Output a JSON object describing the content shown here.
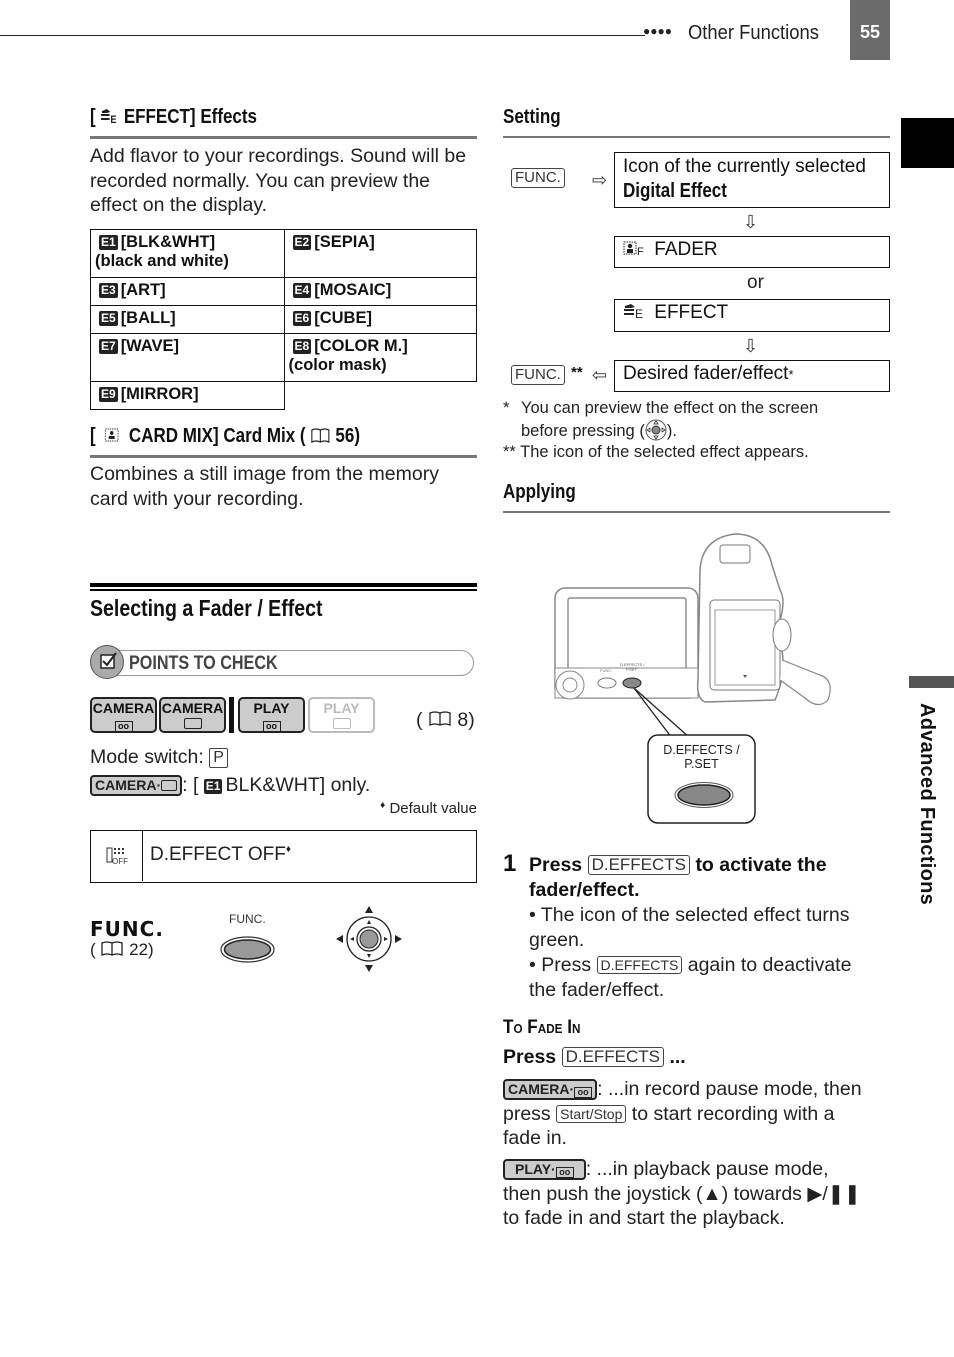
{
  "header": {
    "dots": "●●●●",
    "section_title": "Other Functions",
    "page_number": "55"
  },
  "side_tab": {
    "label": "Advanced Functions"
  },
  "effects": {
    "heading_prefix": "[",
    "heading_text": "EFFECT] Effects",
    "icon": "effect-icon",
    "description": "Add flavor to your recordings. Sound will be recorded normally. You can preview the effect on the display.",
    "table": [
      [
        {
          "badge": "E1",
          "label": "[BLK&WHT]",
          "sub": "(black and white)"
        },
        {
          "badge": "E2",
          "label": "[SEPIA]",
          "sub": ""
        }
      ],
      [
        {
          "badge": "E3",
          "label": "[ART]",
          "sub": ""
        },
        {
          "badge": "E4",
          "label": "[MOSAIC]",
          "sub": ""
        }
      ],
      [
        {
          "badge": "E5",
          "label": "[BALL]",
          "sub": ""
        },
        {
          "badge": "E6",
          "label": "[CUBE]",
          "sub": ""
        }
      ],
      [
        {
          "badge": "E7",
          "label": "[WAVE]",
          "sub": ""
        },
        {
          "badge": "E8",
          "label": "[COLOR M.]",
          "sub": "(color mask)"
        }
      ],
      [
        {
          "badge": "E9",
          "label": "[MIRROR]",
          "sub": ""
        }
      ]
    ]
  },
  "card_mix": {
    "heading_prefix": "[",
    "heading_text": "CARD MIX] Card Mix (",
    "page_ref": "56)",
    "description": "Combines a still image from the memory card with your recording."
  },
  "selecting": {
    "title": "Selecting a Fader / Effect",
    "points_to_check": "POINTS TO CHECK",
    "modes": [
      {
        "label": "CAMERA",
        "media": "tape",
        "active": true
      },
      {
        "label": "CAMERA",
        "media": "card",
        "active": true
      },
      {
        "label": "PLAY",
        "media": "tape",
        "active": true
      },
      {
        "label": "PLAY",
        "media": "card",
        "active": false
      }
    ],
    "mode_ref_open": "(",
    "mode_ref_page": "8)",
    "mode_switch_label": "Mode switch:",
    "mode_switch_value": "P",
    "camera_card_pill": "CAMERA·",
    "camera_card_note_pre": ": [",
    "camera_card_badge": "E1",
    "camera_card_note_post": "BLK&WHT] only.",
    "default_mark": "♦",
    "default_value_label": "Default value",
    "setting_icon_label": "OFF",
    "setting_value": "D.EFFECT OFF",
    "func_label": "FUNC.",
    "func_ref_open": "(",
    "func_ref_page": "22)",
    "func_button_caption": "FUNC."
  },
  "setting": {
    "title": "Setting",
    "func_key": "FUNC.",
    "box1_line1": "Icon of the currently selected",
    "box1_line2": "Digital Effect",
    "fader_label": "FADER",
    "or_label": "or",
    "effect_label": "EFFECT",
    "return_marks": "**",
    "box_desired": "Desired fader/effect",
    "desired_mark": "*",
    "footnote1_mark": "*",
    "footnote1_a": "You can preview the effect on the screen",
    "footnote1_b_pre": "before pressing (",
    "footnote1_b_post": ").",
    "footnote2": "** The icon of the selected effect appears."
  },
  "applying": {
    "title": "Applying",
    "callout_line1": "D.EFFECTS /",
    "callout_line2": "P.SET",
    "cam_small_func": "FUNC.",
    "cam_small_deff": "D.EFFECTS / P.SET",
    "step_num": "1",
    "step_press": "Press",
    "step_key": "D.EFFECTS",
    "step_rest1": "to activate the",
    "step_rest2": "fader/effect.",
    "bullet1_a": "• The icon of the selected effect turns",
    "bullet1_b": "green.",
    "bullet2_pre": "• Press",
    "bullet2_key": "D.EFFECTS",
    "bullet2_post": "again to deactivate",
    "bullet2_b": "the fader/effect.",
    "fade_in_title": "To Fade In",
    "fade_press": "Press",
    "fade_key": "D.EFFECTS",
    "fade_ellipsis": "...",
    "cam_pill": "CAMERA·",
    "cam_text1": ": ...in record pause mode, then",
    "cam_text2_pre": "press",
    "cam_key": "Start/Stop",
    "cam_text2_post": "to start recording with a",
    "cam_text3": "fade in.",
    "play_pill": "PLAY·",
    "play_text1": ": ...in playback pause mode,",
    "play_text2": "then push the joystick (▲) towards ▶/❚❚",
    "play_text3": "to fade in and start the playback."
  }
}
